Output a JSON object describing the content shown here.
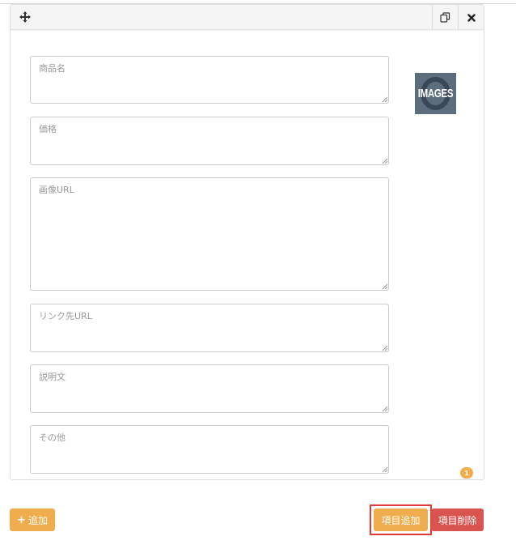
{
  "panel": {
    "icons": {
      "move": "move-arrows-icon",
      "copy": "copy-icon",
      "close": "close-x-icon"
    },
    "fields": [
      {
        "name": "product-name",
        "placeholder": "商品名"
      },
      {
        "name": "price",
        "placeholder": "価格"
      },
      {
        "name": "image-url",
        "placeholder": "画像URL"
      },
      {
        "name": "link-url",
        "placeholder": "リンク先URL"
      },
      {
        "name": "description",
        "placeholder": "説明文"
      },
      {
        "name": "other",
        "placeholder": "その他"
      }
    ],
    "thumbnail": {
      "text": "IMAGES"
    },
    "badge": "1"
  },
  "footer": {
    "add_label": "追加",
    "add_item_label": "項目追加",
    "delete_item_label": "項目削除"
  },
  "colors": {
    "warning": "#f0ad4e",
    "danger": "#d9534f",
    "highlight": "#e53935"
  }
}
